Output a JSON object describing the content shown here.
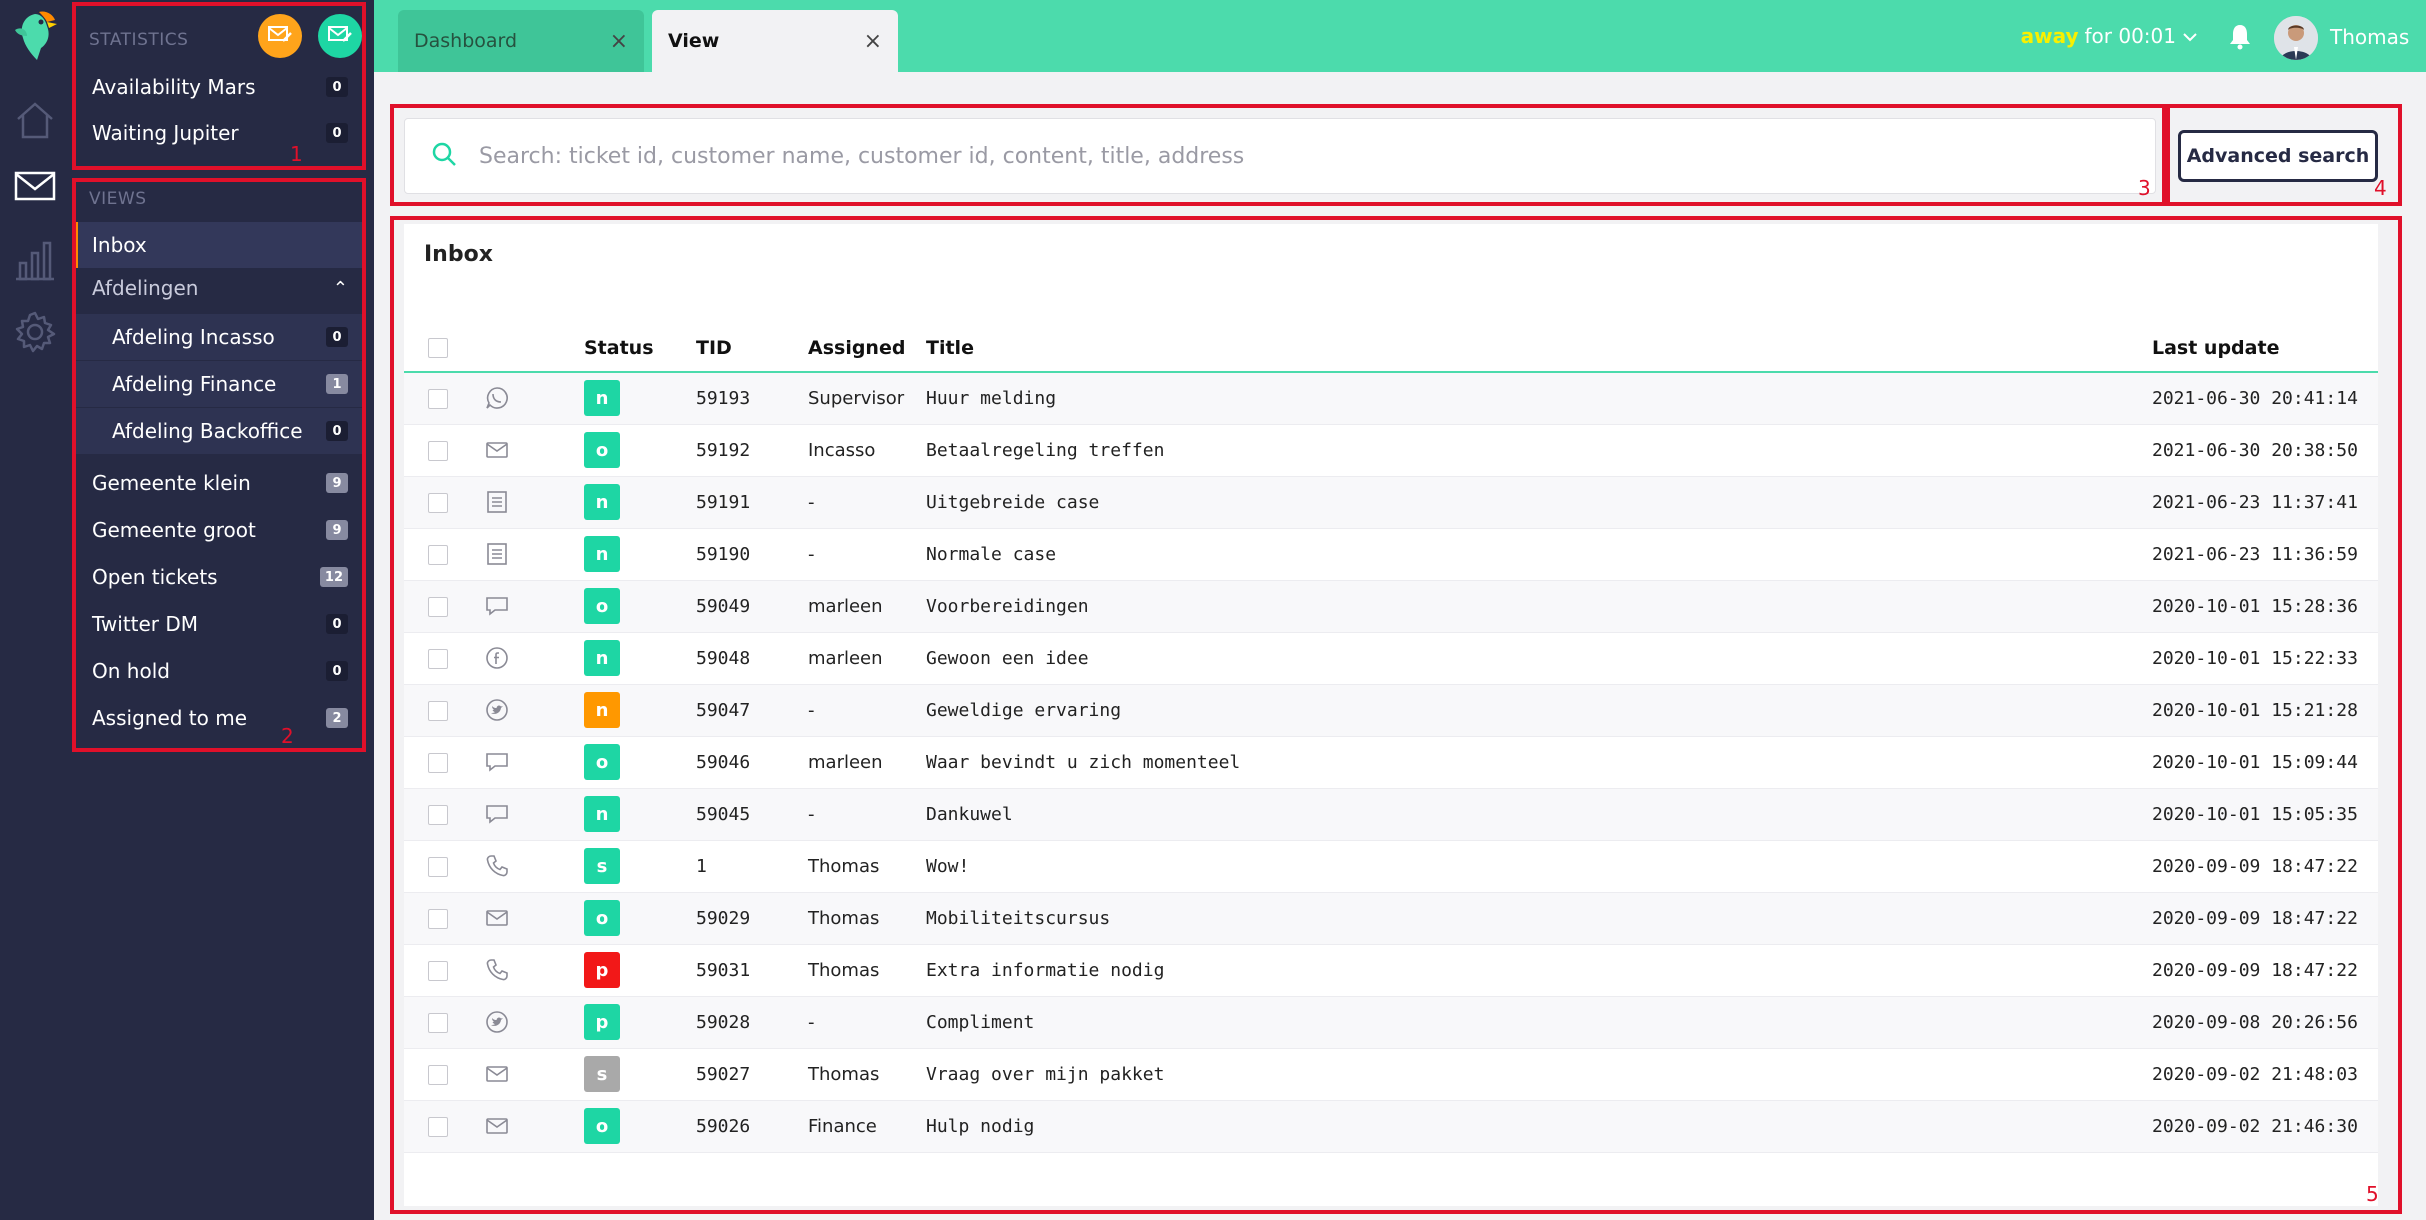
{
  "colors": {
    "brand": "#4cdbac",
    "sidebar": "#262a44",
    "accent_orange": "#ff8a00",
    "annotation_red": "#e0102a",
    "status_green": "#1ed6a4",
    "status_orange": "#ff9800",
    "status_red": "#f21818",
    "status_grey": "#a9a9a9"
  },
  "rail": {
    "icons": [
      "parrot-logo-icon",
      "home-icon",
      "mail-icon",
      "statistics-icon",
      "settings-icon"
    ]
  },
  "statistics": {
    "header": "STATISTICS",
    "items": [
      {
        "label": "Availability Mars",
        "count": "0"
      },
      {
        "label": "Waiting Jupiter",
        "count": "0"
      }
    ]
  },
  "views": {
    "header": "VIEWS",
    "inbox": "Inbox",
    "group": "Afdelingen",
    "sub_items": [
      {
        "label": "Afdeling Incasso",
        "count": "0"
      },
      {
        "label": "Afdeling Finance",
        "count": "1"
      },
      {
        "label": "Afdeling Backoffice",
        "count": "0"
      }
    ],
    "items": [
      {
        "label": "Gemeente klein",
        "count": "9"
      },
      {
        "label": "Gemeente groot",
        "count": "9"
      },
      {
        "label": "Open tickets",
        "count": "12"
      },
      {
        "label": "Twitter DM",
        "count": "0"
      },
      {
        "label": "On hold",
        "count": "0"
      },
      {
        "label": "Assigned to me",
        "count": "2"
      }
    ]
  },
  "tabs": [
    {
      "label": "Dashboard",
      "close": "×"
    },
    {
      "label": "View",
      "close": "×"
    }
  ],
  "status": {
    "state": "away",
    "rest": "for 00:01"
  },
  "user": {
    "name": "Thomas"
  },
  "search": {
    "placeholder": "Search: ticket id, customer name, customer id, content, title, address",
    "advanced_label": "Advanced search"
  },
  "inbox": {
    "title": "Inbox",
    "columns": {
      "status": "Status",
      "tid": "TID",
      "assigned": "Assigned",
      "title": "Title",
      "updated": "Last update"
    },
    "rows": [
      {
        "channel": "whatsapp",
        "status": "n",
        "status_color": "#1ed6a4",
        "tid": "59193",
        "assigned": "Supervisor",
        "title": "Huur melding",
        "updated": "2021-06-30 20:41:14"
      },
      {
        "channel": "email",
        "status": "o",
        "status_color": "#1ed6a4",
        "tid": "59192",
        "assigned": "Incasso",
        "title": "Betaalregeling treffen",
        "updated": "2021-06-30 20:38:50"
      },
      {
        "channel": "form",
        "status": "n",
        "status_color": "#1ed6a4",
        "tid": "59191",
        "assigned": "-",
        "title": "Uitgebreide case",
        "updated": "2021-06-23 11:37:41"
      },
      {
        "channel": "form",
        "status": "n",
        "status_color": "#1ed6a4",
        "tid": "59190",
        "assigned": "-",
        "title": "Normale case",
        "updated": "2021-06-23 11:36:59"
      },
      {
        "channel": "chat",
        "status": "o",
        "status_color": "#1ed6a4",
        "tid": "59049",
        "assigned": "marleen",
        "title": "Voorbereidingen",
        "updated": "2020-10-01 15:28:36"
      },
      {
        "channel": "facebook",
        "status": "n",
        "status_color": "#1ed6a4",
        "tid": "59048",
        "assigned": "marleen",
        "title": "Gewoon een idee",
        "updated": "2020-10-01 15:22:33"
      },
      {
        "channel": "twitter",
        "status": "n",
        "status_color": "#ff9800",
        "tid": "59047",
        "assigned": "-",
        "title": "Geweldige ervaring",
        "updated": "2020-10-01 15:21:28"
      },
      {
        "channel": "chat",
        "status": "o",
        "status_color": "#1ed6a4",
        "tid": "59046",
        "assigned": "marleen",
        "title": "Waar bevindt u zich momenteel",
        "updated": "2020-10-01 15:09:44"
      },
      {
        "channel": "chat",
        "status": "n",
        "status_color": "#1ed6a4",
        "tid": "59045",
        "assigned": "-",
        "title": "Dankuwel",
        "updated": "2020-10-01 15:05:35"
      },
      {
        "channel": "phone",
        "status": "s",
        "status_color": "#1ed6a4",
        "tid": "1",
        "assigned": "Thomas",
        "title": "Wow!",
        "updated": "2020-09-09 18:47:22"
      },
      {
        "channel": "email",
        "status": "o",
        "status_color": "#1ed6a4",
        "tid": "59029",
        "assigned": "Thomas",
        "title": "Mobiliteitscursus",
        "updated": "2020-09-09 18:47:22"
      },
      {
        "channel": "phone",
        "status": "p",
        "status_color": "#f21818",
        "tid": "59031",
        "assigned": "Thomas",
        "title": "Extra informatie nodig",
        "updated": "2020-09-09 18:47:22"
      },
      {
        "channel": "twitter",
        "status": "p",
        "status_color": "#1ed6a4",
        "tid": "59028",
        "assigned": "-",
        "title": "Compliment",
        "updated": "2020-09-08 20:26:56"
      },
      {
        "channel": "email",
        "status": "s",
        "status_color": "#a9a9a9",
        "tid": "59027",
        "assigned": "Thomas",
        "title": "Vraag over mijn pakket",
        "updated": "2020-09-02 21:48:03"
      },
      {
        "channel": "email",
        "status": "o",
        "status_color": "#1ed6a4",
        "tid": "59026",
        "assigned": "Finance",
        "title": "Hulp nodig",
        "updated": "2020-09-02 21:46:30"
      }
    ]
  },
  "annotations": [
    "1",
    "2",
    "3",
    "4",
    "5"
  ]
}
